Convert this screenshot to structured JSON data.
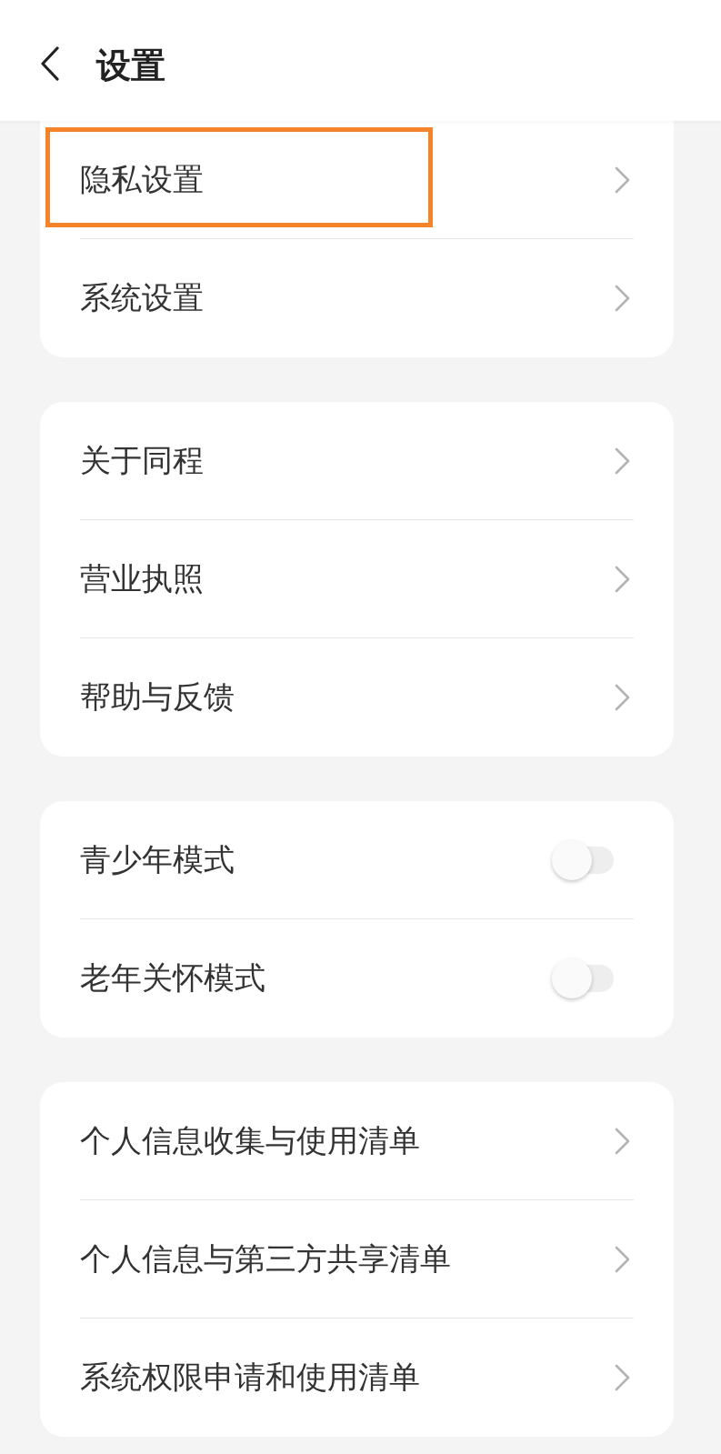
{
  "header": {
    "title": "设置"
  },
  "groups": [
    {
      "items": [
        {
          "kind": "link",
          "label": "隐私设置",
          "highlighted": true
        },
        {
          "kind": "link",
          "label": "系统设置",
          "highlighted": false
        }
      ]
    },
    {
      "items": [
        {
          "kind": "link",
          "label": "关于同程",
          "highlighted": false
        },
        {
          "kind": "link",
          "label": "营业执照",
          "highlighted": false
        },
        {
          "kind": "link",
          "label": "帮助与反馈",
          "highlighted": false
        }
      ]
    },
    {
      "items": [
        {
          "kind": "toggle",
          "label": "青少年模式",
          "on": false
        },
        {
          "kind": "toggle",
          "label": "老年关怀模式",
          "on": false
        }
      ]
    },
    {
      "items": [
        {
          "kind": "link",
          "label": "个人信息收集与使用清单",
          "highlighted": false
        },
        {
          "kind": "link",
          "label": "个人信息与第三方共享清单",
          "highlighted": false
        },
        {
          "kind": "link",
          "label": "系统权限申请和使用清单",
          "highlighted": false
        }
      ]
    }
  ]
}
